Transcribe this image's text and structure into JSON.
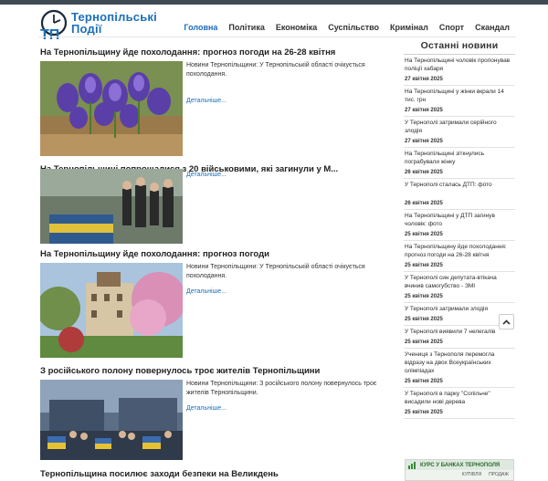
{
  "site": {
    "name_line1": "Тернопільські",
    "name_line2": "Події"
  },
  "nav": [
    {
      "label": "Головна",
      "active": true
    },
    {
      "label": "Політика",
      "active": false
    },
    {
      "label": "Економіка",
      "active": false
    },
    {
      "label": "Суспільство",
      "active": false
    },
    {
      "label": "Кримінал",
      "active": false
    },
    {
      "label": "Спорт",
      "active": false
    },
    {
      "label": "Скандал",
      "active": false
    }
  ],
  "articles": [
    {
      "title": "На Тернопільщину йде похолодання: прогноз погоди на 26-28 квітня",
      "excerpt": "Новини Тернопільщини: У Тернопільській області очікується похолодання.",
      "more": "Детальніше..."
    },
    {
      "title": "На Тернопільщині попрощалися з 20 військовими, які загинули у М...",
      "excerpt": "",
      "more": "Детальніше..."
    },
    {
      "title": "На Тернопільщину йде похолодання: прогноз погоди",
      "excerpt": "Новини Тернопільщини: У Тернопільській області очікується похолодання.",
      "more": "Детальніше..."
    },
    {
      "title": "З російського полону повернулось троє жителів Тернопільщини",
      "excerpt": "Новини Тернопільщини: З російського полону повернулось троє жителів Тернопільщини.",
      "more": "Детальніше..."
    },
    {
      "title": "Тернопільщина посилює заходи безпеки на Великдень",
      "excerpt": "",
      "more": ""
    }
  ],
  "sidebar": {
    "title": "Останні новини",
    "items": [
      {
        "text": "На Тернопільщині чоловік пропонував поліції хабаря",
        "date": "27 квітня 2025"
      },
      {
        "text": "На Тернопільщині у жінки вкрали 14 тис. грн",
        "date": "27 квітня 2025"
      },
      {
        "text": "У Тернополі затримали серійного злодія",
        "date": "27 квітня 2025"
      },
      {
        "text": "На Тернопільщині зіткнулись пограбували жінку",
        "date": "26 квітня 2025"
      },
      {
        "text": "У Тернополі сталась ДТП: фото",
        "date": "26 квітня 2025"
      },
      {
        "text": "На Тернопільщині у ДТП загинув чоловік: фото",
        "date": "25 квітня 2025"
      },
      {
        "text": "На Тернопільщину йде похолодання: прогноз погоди на 26-28 квітня",
        "date": "25 квітня 2025"
      },
      {
        "text": "У Тернополі син депутата-втікача вчинив самогубство - ЗМІ",
        "date": "25 квітня 2025"
      },
      {
        "text": "У Тернополі затримали злодія",
        "date": "25 квітня 2025"
      },
      {
        "text": "У Тернополі виявили 7 нелегалів",
        "date": "25 квітня 2025"
      },
      {
        "text": "Учениця з Тернополя перемогла відразу на двох Всеукраїнських олімпіадах",
        "date": "25 квітня 2025"
      },
      {
        "text": "У Тернополі в парку \"Сопільче\" висадили нові дерева",
        "date": "25 квітня 2025"
      }
    ]
  },
  "currency": {
    "title": "КУРС У БАНКАХ ТЕРНОПОЛЯ",
    "col_buy": "КУПІВЛЯ",
    "col_sell": "ПРОДАЖ"
  },
  "colors": {
    "brand": "#1b6fb8",
    "topbar": "#3f4a55"
  }
}
